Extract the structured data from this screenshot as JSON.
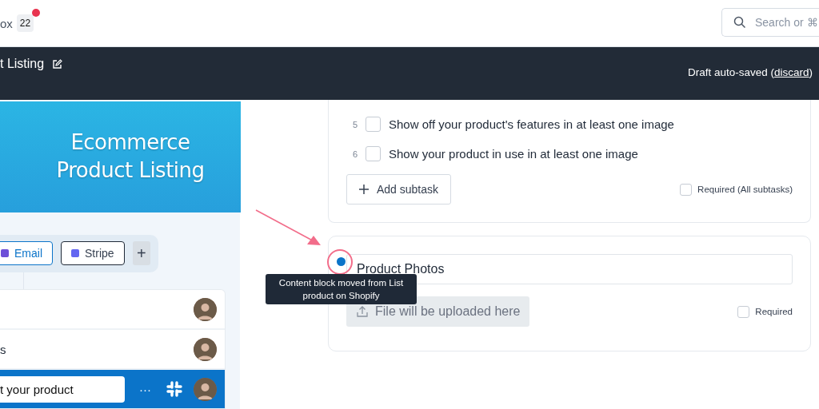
{
  "header": {
    "app_label": "ox",
    "badge": "22",
    "notification": true,
    "search": {
      "placeholder": "Search or ⌘"
    }
  },
  "title_bar": {
    "title": "t Listing",
    "status_prefix": "Draft auto-saved (",
    "status_link": "discard",
    "status_suffix": ")"
  },
  "banner": {
    "title": "Ecommerce Product Listing"
  },
  "integrations": [
    {
      "label": "Email",
      "selected": true
    },
    {
      "label": "Stripe",
      "selected": false
    }
  ],
  "add_integration": "+",
  "tasks": [
    {
      "kind": "row",
      "selected": false
    },
    {
      "kind": "row",
      "title": "s",
      "selected": false
    },
    {
      "kind": "editing",
      "title": "t your product",
      "selected": true,
      "more": "···"
    }
  ],
  "subtasks": [
    {
      "number": "5",
      "text": "Show off your product's features in at least one image",
      "checked": false
    },
    {
      "number": "6",
      "text": "Show your product in use in at least one image",
      "checked": false
    }
  ],
  "add_subtask": "Add subtask",
  "required_all": {
    "label": "Required (All subtasks)",
    "checked": false
  },
  "upload_block": {
    "title": "Product Photos",
    "upload_label": "File will be uploaded here",
    "upload_disabled": true,
    "required": {
      "label": "Required",
      "checked": false
    }
  },
  "tooltip": "Content block moved from List product on Shopify"
}
